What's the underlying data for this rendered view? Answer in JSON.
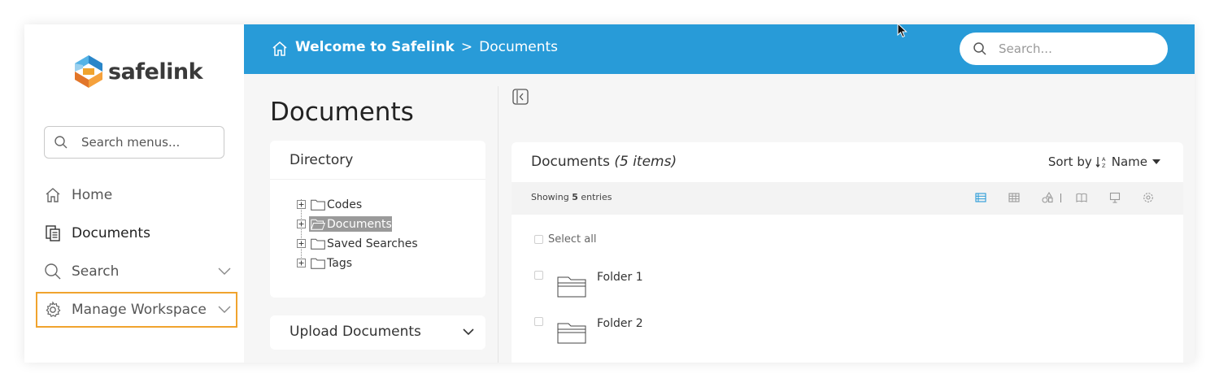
{
  "app": {
    "logo_text": "safelink",
    "brand_color": "#289bd8",
    "accent_color": "#f0a32e"
  },
  "sidebar": {
    "search_placeholder": "Search menus...",
    "items": [
      {
        "label": "Home",
        "icon": "home-icon"
      },
      {
        "label": "Documents",
        "icon": "documents-icon"
      },
      {
        "label": "Search",
        "icon": "search-icon",
        "expandable": true
      },
      {
        "label": "Manage Workspace",
        "icon": "gear-icon",
        "expandable": true,
        "highlighted": true
      }
    ]
  },
  "header": {
    "breadcrumb_root": "Welcome to Safelink",
    "breadcrumb_separator": ">",
    "breadcrumb_current": "Documents",
    "search_placeholder": "Search..."
  },
  "main": {
    "page_title": "Documents",
    "directory": {
      "title": "Directory",
      "tree": [
        {
          "label": "Codes",
          "selected": false
        },
        {
          "label": "Documents",
          "selected": true
        },
        {
          "label": "Saved Searches",
          "selected": false
        },
        {
          "label": "Tags",
          "selected": false
        }
      ]
    },
    "upload": {
      "title": "Upload Documents"
    },
    "listing": {
      "title": "Documents",
      "count_label": "(5 items)",
      "sort_prefix": "Sort by",
      "sort_field": "Name",
      "showing_prefix": "Showing",
      "showing_count": "5",
      "showing_suffix": "entries",
      "select_all_label": "Select all",
      "view_icons": [
        "list-view-icon",
        "grid-view-icon",
        "shapes-view-icon",
        "book-view-icon",
        "presentation-view-icon",
        "settings-icon"
      ],
      "items": [
        {
          "name": "Folder 1",
          "icon": "folder-icon"
        },
        {
          "name": "Folder 2",
          "icon": "folder-icon"
        }
      ]
    }
  }
}
